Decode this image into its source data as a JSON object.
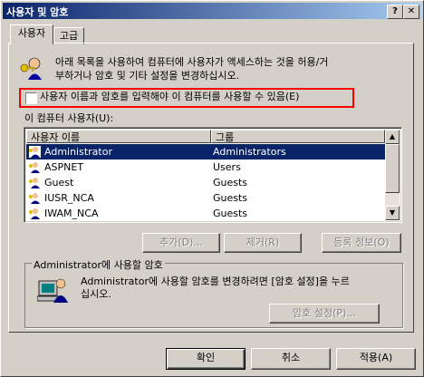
{
  "window": {
    "title": "사용자 및 암호",
    "help_glyph": "?",
    "close_glyph": "✕"
  },
  "tabs": [
    {
      "label": "사용자"
    },
    {
      "label": "고급"
    }
  ],
  "intro_text_line1": "아래 목록을 사용하여 컴퓨터에 사용자가 액세스하는 것을 허용/거",
  "intro_text_line2": "부하거나 암호 및 기타 설정을 변경하십시오.",
  "checkbox": {
    "label": "사용자 이름과 암호를 입력해야 이 컴퓨터를 사용할 수 있음(E)",
    "checked": false
  },
  "users_section_label": "이 컴퓨터 사용자(U):",
  "list": {
    "columns": [
      "사용자 이름",
      "그룹"
    ],
    "rows": [
      {
        "name": "Administrator",
        "group": "Administrators",
        "selected": true
      },
      {
        "name": "ASPNET",
        "group": "Users",
        "selected": false
      },
      {
        "name": "Guest",
        "group": "Guests",
        "selected": false
      },
      {
        "name": "IUSR_NCA",
        "group": "Guests",
        "selected": false
      },
      {
        "name": "IWAM_NCA",
        "group": "Guests",
        "selected": false
      }
    ]
  },
  "list_buttons": {
    "add": "추가(D)...",
    "remove": "제거(R)",
    "properties": "등록 정보(O)"
  },
  "password_group": {
    "title": "Administrator에 사용할 암호",
    "text_line1": "Administrator에 사용할 암호를 변경하려면 [암호 설정]을 누르",
    "text_line2": "십시오.",
    "button": "암호 설정(P)..."
  },
  "footer": {
    "ok": "확인",
    "cancel": "취소",
    "apply": "적용(A)"
  },
  "colors": {
    "titlebar": "#0a246a",
    "selection": "#0a246a",
    "highlight_box": "#ff0000"
  }
}
